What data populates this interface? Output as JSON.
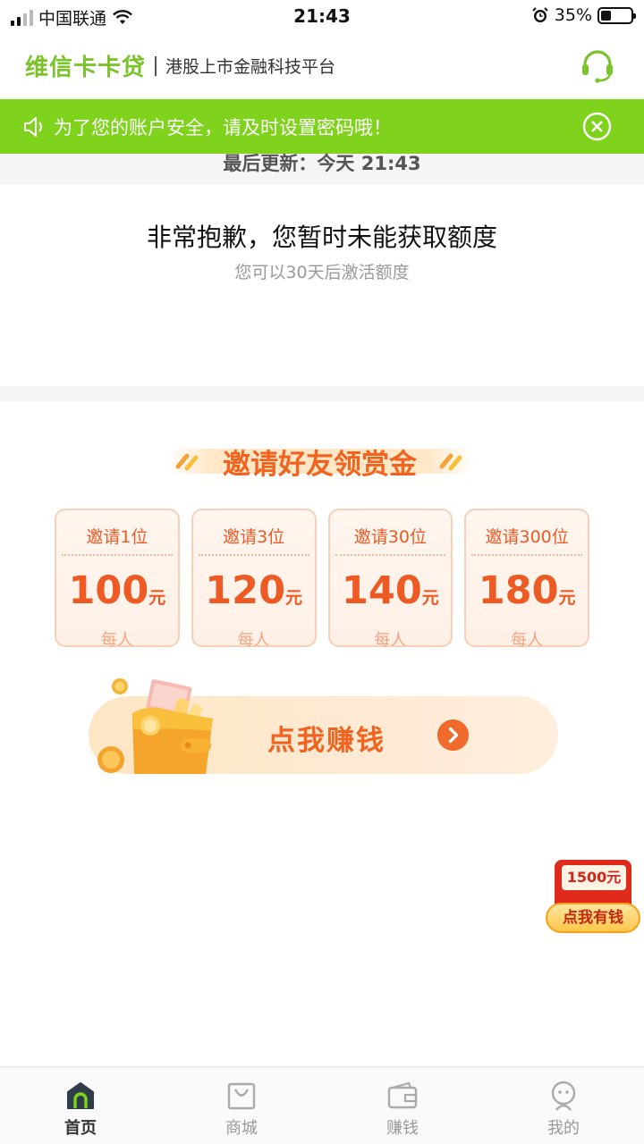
{
  "status_bar": {
    "carrier": "中国联通",
    "time": "21:43",
    "battery_text": "35%"
  },
  "header": {
    "brand": "维信卡卡贷",
    "slogan": "港股上市金融科技平台"
  },
  "notice": {
    "text": "为了您的账户安全，请及时设置密码哦！"
  },
  "update": {
    "text": "最后更新：今天 21:43"
  },
  "quota": {
    "title": "非常抱歉，您暂时未能获取额度",
    "subtitle": "您可以30天后激活额度"
  },
  "invite": {
    "title": "邀请好友领赏金",
    "tiers": [
      {
        "label": "邀请1位",
        "amount": "100",
        "unit": "元",
        "per": "每人"
      },
      {
        "label": "邀请3位",
        "amount": "120",
        "unit": "元",
        "per": "每人"
      },
      {
        "label": "邀请30位",
        "amount": "140",
        "unit": "元",
        "per": "每人"
      },
      {
        "label": "邀请300位",
        "amount": "180",
        "unit": "元",
        "per": "每人"
      }
    ],
    "cta_label": "点我赚钱"
  },
  "promo": {
    "amount": "1500元",
    "button": "点我有钱"
  },
  "tabbar": {
    "tabs": [
      {
        "label": "首页",
        "icon": "home-icon"
      },
      {
        "label": "商城",
        "icon": "shopping-bag-icon"
      },
      {
        "label": "赚钱",
        "icon": "wallet-icon"
      },
      {
        "label": "我的",
        "icon": "profile-icon"
      }
    ]
  },
  "colors": {
    "brand_green": "#7ac32a",
    "notice_green": "#7fd31c",
    "accent_orange": "#f2631f"
  }
}
